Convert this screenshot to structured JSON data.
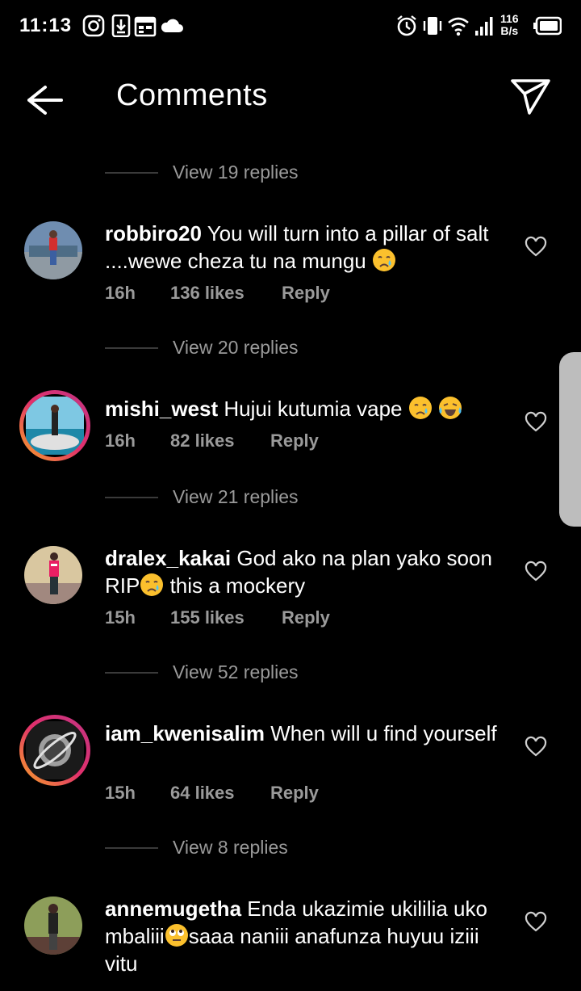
{
  "status_bar": {
    "time": "11:13",
    "net_speed_value": "116",
    "net_speed_unit": "B/s",
    "left_icons": [
      "instagram-icon",
      "download-icon",
      "calendar-icon",
      "cloud-icon"
    ],
    "right_icons": [
      "alarm-icon",
      "vibrate-icon",
      "wifi-icon",
      "signal-icon",
      "battery-icon"
    ]
  },
  "header": {
    "title": "Comments"
  },
  "colors": {
    "background": "#000000",
    "muted": "#9a9a9a",
    "ring_start": "#f9a825",
    "ring_end": "#c13584"
  },
  "comments": [
    {
      "view_replies": "View 19 replies"
    },
    {
      "username": "robbiro20",
      "text": "You will turn into a pillar of salt ....wewe cheza tu na mungu",
      "emoji": [
        "crying-face"
      ],
      "time": "16h",
      "likes": "136 likes",
      "reply": "Reply",
      "view_replies": "View 20 replies"
    },
    {
      "username": "mishi_west",
      "text": "Hujui kutumia vape",
      "emoji": [
        "crying-face",
        "laughing-crying-face"
      ],
      "time": "16h",
      "likes": "82 likes",
      "reply": "Reply",
      "view_replies": "View 21 replies"
    },
    {
      "username": "dralex_kakai",
      "text_before": "God ako na plan yako soon RIP",
      "text_after": " this a mockery",
      "emoji": [
        "crying-face"
      ],
      "time": "15h",
      "likes": "155 likes",
      "reply": "Reply",
      "view_replies": "View 52 replies"
    },
    {
      "username": "iam_kwenisalim",
      "text": "When will u find yourself",
      "time": "15h",
      "likes": "64 likes",
      "reply": "Reply",
      "view_replies": "View 8 replies"
    },
    {
      "username": "annemugetha",
      "text_before": "Enda ukazimie ukililia uko mbaliii",
      "text_after": "saaa naniii anafunza huyuu iziii vitu",
      "emoji": [
        "eye-roll-face"
      ]
    }
  ]
}
